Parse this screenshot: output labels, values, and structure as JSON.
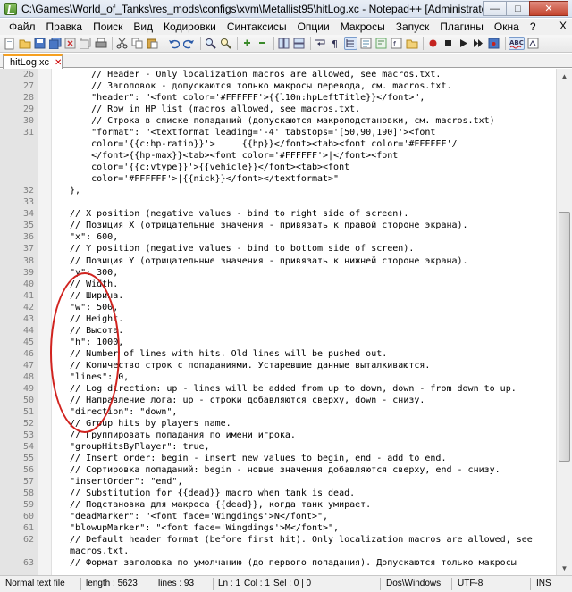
{
  "window": {
    "title": "C:\\Games\\World_of_Tanks\\res_mods\\configs\\xvm\\Metallist95\\hitLog.xc - Notepad++ [Administrator]",
    "minimize": "—",
    "maximize": "□",
    "close": "✕"
  },
  "menu": {
    "items": [
      "Файл",
      "Правка",
      "Поиск",
      "Вид",
      "Кодировки",
      "Синтаксисы",
      "Опции",
      "Макросы",
      "Запуск",
      "Плагины",
      "Окна",
      "?"
    ],
    "close_label": "X"
  },
  "toolbar": {
    "icons": [
      "new-file-icon",
      "open-file-icon",
      "save-icon",
      "save-all-icon",
      "close-icon",
      "close-all-icon",
      "print-icon",
      "cut-icon",
      "copy-icon",
      "paste-icon",
      "undo-icon",
      "redo-icon",
      "find-icon",
      "replace-icon",
      "zoom-in-icon",
      "zoom-out-icon",
      "sync-v-icon",
      "sync-h-icon",
      "wrap-icon",
      "all-chars-icon",
      "indent-guide-icon",
      "udl-icon",
      "doc-map-icon",
      "function-list-icon",
      "folder-workspace-icon",
      "record-macro-icon",
      "stop-macro-icon",
      "play-macro-icon",
      "run-macro-multiple-icon",
      "save-macro-icon",
      "spellcheck-icon",
      "spellcheck-next-icon"
    ]
  },
  "tab": {
    "label": "hitLog.xc"
  },
  "editor": {
    "lines": [
      {
        "n": "26",
        "text": "      // Header - Only localization macros are allowed, see macros.txt."
      },
      {
        "n": "27",
        "text": "      // Заголовок - допускаются только макросы перевода, см. macros.txt."
      },
      {
        "n": "28",
        "text": "      \"header\": \"<font color='#FFFFFF'>{{l10n:hpLeftTitle}}</font>\","
      },
      {
        "n": "29",
        "text": "      // Row in HP list (macros allowed, see macros.txt."
      },
      {
        "n": "30",
        "text": "      // Строка в списке попаданий (допускаются макроподстановки, см. macros.txt)"
      },
      {
        "n": "31",
        "text": "      \"format\": \"<textformat leading='-4' tabstops='[50,90,190]'><font"
      },
      {
        "n": "",
        "text": "      color='{{c:hp-ratio}}'>     {{hp}}</font><tab><font color='#FFFFFF'/"
      },
      {
        "n": "",
        "text": "      </font>{{hp-max}}<tab><font color='#FFFFFF'>|</font><font"
      },
      {
        "n": "",
        "text": "      color='{{c:vtype}}'>{{vehicle}}</font><tab><font"
      },
      {
        "n": "",
        "text": "      color='#FFFFFF'>|{{nick}}</font></textformat>\""
      },
      {
        "n": "32",
        "text": "  },"
      },
      {
        "n": "33",
        "text": ""
      },
      {
        "n": "34",
        "text": "  // X position (negative values - bind to right side of screen)."
      },
      {
        "n": "35",
        "text": "  // Позиция X (отрицательные значения - привязать к правой стороне экрана)."
      },
      {
        "n": "36",
        "text": "  \"x\": 600,"
      },
      {
        "n": "37",
        "text": "  // Y position (negative values - bind to bottom side of screen)."
      },
      {
        "n": "38",
        "text": "  // Позиция Y (отрицательные значения - привязать к нижней стороне экрана)."
      },
      {
        "n": "39",
        "text": "  \"y\": 300,"
      },
      {
        "n": "40",
        "text": "  // Width."
      },
      {
        "n": "41",
        "text": "  // Ширина."
      },
      {
        "n": "42",
        "text": "  \"w\": 500,"
      },
      {
        "n": "43",
        "text": "  // Height."
      },
      {
        "n": "44",
        "text": "  // Высота."
      },
      {
        "n": "45",
        "text": "  \"h\": 1000,"
      },
      {
        "n": "46",
        "text": "  // Number of lines with hits. Old lines will be pushed out."
      },
      {
        "n": "47",
        "text": "  // Количество строк с попаданиями. Устаревшие данные выталкиваются."
      },
      {
        "n": "48",
        "text": "  \"lines\": 0,"
      },
      {
        "n": "49",
        "text": "  // Log direction: up - lines will be added from up to down, down - from down to up."
      },
      {
        "n": "50",
        "text": "  // Направление лога: up - строки добавляются сверху, down - снизу."
      },
      {
        "n": "51",
        "text": "  \"direction\": \"down\","
      },
      {
        "n": "52",
        "text": "  // Group hits by players name."
      },
      {
        "n": "53",
        "text": "  // Группировать попадания по имени игрока."
      },
      {
        "n": "54",
        "text": "  \"groupHitsByPlayer\": true,"
      },
      {
        "n": "55",
        "text": "  // Insert order: begin - insert new values to begin, end - add to end."
      },
      {
        "n": "56",
        "text": "  // Сортировка попаданий: begin - новые значения добавляются сверху, end - снизу."
      },
      {
        "n": "57",
        "text": "  \"insertOrder\": \"end\","
      },
      {
        "n": "58",
        "text": "  // Substitution for {{dead}} macro when tank is dead."
      },
      {
        "n": "59",
        "text": "  // Подстановка для макроса {{dead}}, когда танк умирает."
      },
      {
        "n": "60",
        "text": "  \"deadMarker\": \"<font face='Wingdings'>N</font>\","
      },
      {
        "n": "61",
        "text": "  \"blowupMarker\": \"<font face='Wingdings'>M</font>\","
      },
      {
        "n": "62",
        "text": "  // Default header format (before first hit). Only localization macros are allowed, see"
      },
      {
        "n": "",
        "text": "  macros.txt."
      },
      {
        "n": "63",
        "text": "  // Формат заголовка по умолчанию (до первого попадания). Допускаются только макросы"
      }
    ]
  },
  "statusbar": {
    "file_type": "Normal text file",
    "length": "length : 5623",
    "lines": "lines : 93",
    "cursor_ln": "Ln : 1",
    "cursor_col": "Col : 1",
    "sel": "Sel : 0 | 0",
    "eol": "Dos\\Windows",
    "encoding": "UTF-8",
    "mode": "INS"
  },
  "colors": {
    "annotation": "#d1231f",
    "tab_accent": "#f6a020"
  }
}
